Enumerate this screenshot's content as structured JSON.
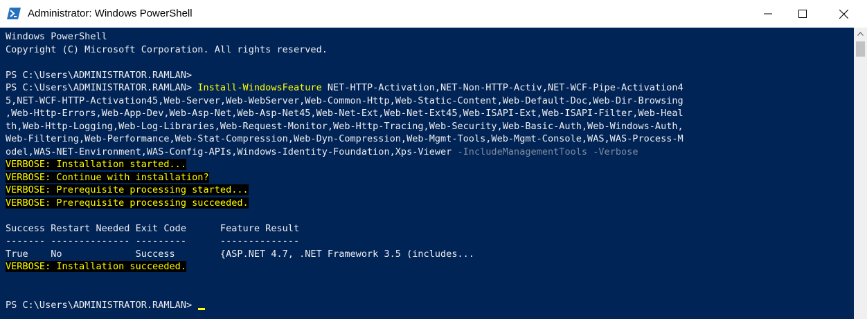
{
  "window": {
    "title": "Administrator: Windows PowerShell",
    "minimize_glyph": "—",
    "maximize_glyph": "☐",
    "close_glyph": "✕"
  },
  "terminal": {
    "l1": "Windows PowerShell",
    "l2": "Copyright (C) Microsoft Corporation. All rights reserved.",
    "l3": "",
    "l4": "PS C:\\Users\\ADMINISTRATOR.RAMLAN>",
    "l5_prompt": "PS C:\\Users\\ADMINISTRATOR.RAMLAN> ",
    "l5_cmd": "Install-WindowsFeature",
    "l5_args": " NET-HTTP-Activation,NET-Non-HTTP-Activ,NET-WCF-Pipe-Activation4",
    "l6": "5,NET-WCF-HTTP-Activation45,Web-Server,Web-WebServer,Web-Common-Http,Web-Static-Content,Web-Default-Doc,Web-Dir-Browsing",
    "l7": ",Web-Http-Errors,Web-App-Dev,Web-Asp-Net,Web-Asp-Net45,Web-Net-Ext,Web-Net-Ext45,Web-ISAPI-Ext,Web-ISAPI-Filter,Web-Heal",
    "l8": "th,Web-Http-Logging,Web-Log-Libraries,Web-Request-Monitor,Web-Http-Tracing,Web-Security,Web-Basic-Auth,Web-Windows-Auth,",
    "l9": "Web-Filtering,Web-Performance,Web-Stat-Compression,Web-Dyn-Compression,Web-Mgmt-Tools,Web-Mgmt-Console,WAS,WAS-Process-M",
    "l10_args": "odel,WAS-NET-Environment,WAS-Config-APIs,Windows-Identity-Foundation,Xps-Viewer ",
    "l10_params": "-IncludeManagementTools -Verbose",
    "v1": "VERBOSE: Installation started...",
    "v2": "VERBOSE: Continue with installation?",
    "v3": "VERBOSE: Prerequisite processing started...",
    "v4": "VERBOSE: Prerequisite processing succeeded.",
    "blank": "",
    "table_header": "Success Restart Needed Exit Code      Feature Result",
    "table_sep": "------- -------------- ---------      --------------",
    "table_row": "True    No             Success        {ASP.NET 4.7, .NET Framework 3.5 (includes...",
    "v5": "VERBOSE: Installation succeeded.",
    "final_prompt": "PS C:\\Users\\ADMINISTRATOR.RAMLAN> "
  },
  "icons": {
    "app": "powershell-icon",
    "minimize": "minimize-icon",
    "maximize": "maximize-icon",
    "close": "close-icon",
    "scroll_up": "chevron-up-icon"
  },
  "colors": {
    "console_bg": "#012456",
    "console_fg": "#eeedf0",
    "command": "#ffff00",
    "parameter": "#7e8c9c",
    "verbose_bg": "#000000",
    "verbose_fg": "#ffff00"
  }
}
